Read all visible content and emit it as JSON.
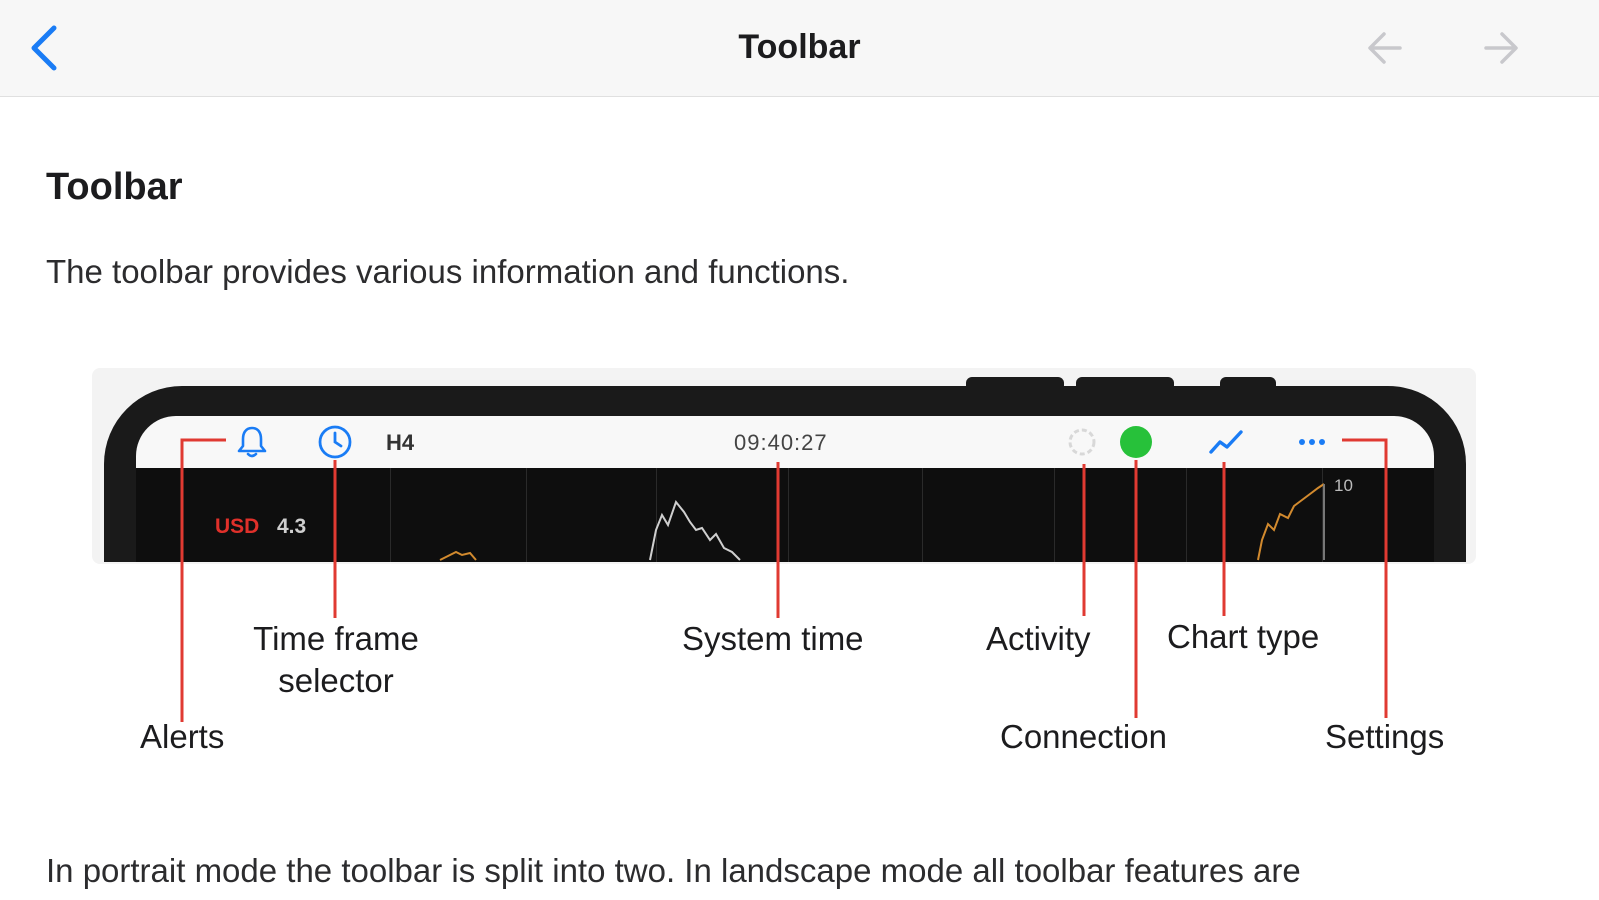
{
  "nav": {
    "title": "Toolbar",
    "back_icon": "chevron-left-icon",
    "prev_icon": "arrow-left-icon",
    "next_icon": "arrow-right-icon",
    "accent_color": "#1a7cf5",
    "disabled_color": "#c8c8cc"
  },
  "content": {
    "heading": "Toolbar",
    "intro": "The toolbar provides various information and functions.",
    "bottom_text": "In portrait mode the toolbar is split into two. In landscape mode all toolbar features are"
  },
  "illustration": {
    "toolbar": {
      "alerts_icon": "bell-icon",
      "timeframe_icon": "clock-icon",
      "timeframe_value": "H4",
      "system_time": "09:40:27",
      "activity_icon": "spinner-icon",
      "connection_icon": "status-dot-icon",
      "connection_color": "#27c13a",
      "chart_type_icon": "line-chart-icon",
      "settings_icon": "more-dots-icon"
    },
    "chart": {
      "currency": "USD",
      "value": "4.3",
      "corner_value": "10"
    },
    "callout_color": "#e03a32",
    "labels": {
      "alerts": "Alerts",
      "timeframe_line1": "Time frame",
      "timeframe_line2": "selector",
      "system_time": "System time",
      "activity": "Activity",
      "chart_type": "Chart type",
      "connection": "Connection",
      "settings": "Settings"
    }
  }
}
